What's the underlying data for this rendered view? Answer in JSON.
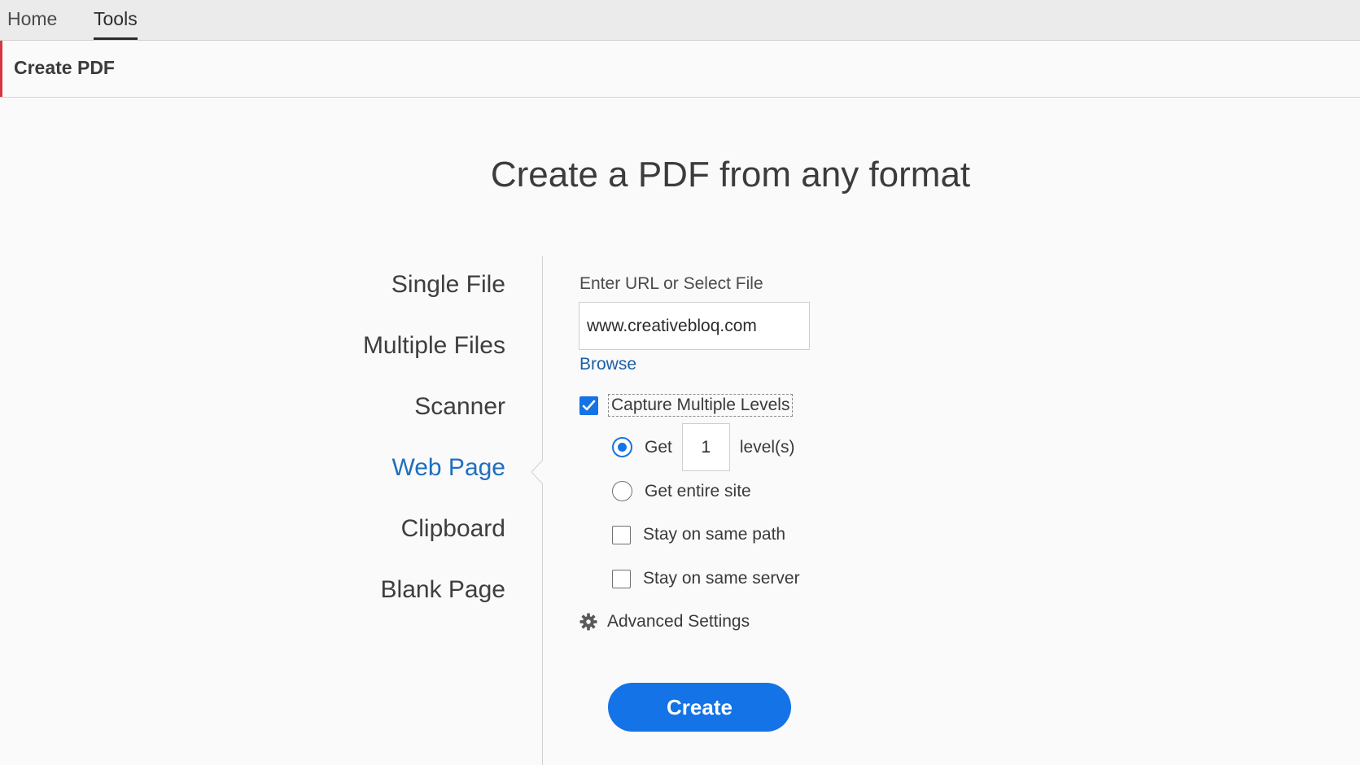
{
  "nav": {
    "tabs": [
      {
        "label": "Home"
      },
      {
        "label": "Tools"
      }
    ]
  },
  "tool": {
    "title": "Create PDF"
  },
  "main": {
    "heading": "Create a PDF from any format",
    "sources": [
      {
        "label": "Single File"
      },
      {
        "label": "Multiple Files"
      },
      {
        "label": "Scanner"
      },
      {
        "label": "Web Page"
      },
      {
        "label": "Clipboard"
      },
      {
        "label": "Blank Page"
      }
    ],
    "active_source": "Web Page"
  },
  "web_page": {
    "url_label": "Enter URL or Select File",
    "url_value": "www.creativebloq.com",
    "browse_label": "Browse",
    "capture_label": "Capture Multiple Levels",
    "capture_checked": true,
    "get_label": "Get",
    "levels_value": "1",
    "levels_suffix": "level(s)",
    "entire_site_label": "Get entire site",
    "selected_option": "Get",
    "same_path_label": "Stay on same path",
    "same_path_checked": false,
    "same_server_label": "Stay on same server",
    "same_server_checked": false,
    "advanced_label": "Advanced Settings",
    "advanced_icon": "gear-icon",
    "create_label": "Create"
  },
  "colors": {
    "accent_blue": "#1473e6",
    "active_text": "#1f6fbf",
    "link": "#1a5fa8",
    "tool_accent": "#d7373f",
    "nav_bg": "#ebebeb",
    "page_bg": "#fafafa"
  }
}
